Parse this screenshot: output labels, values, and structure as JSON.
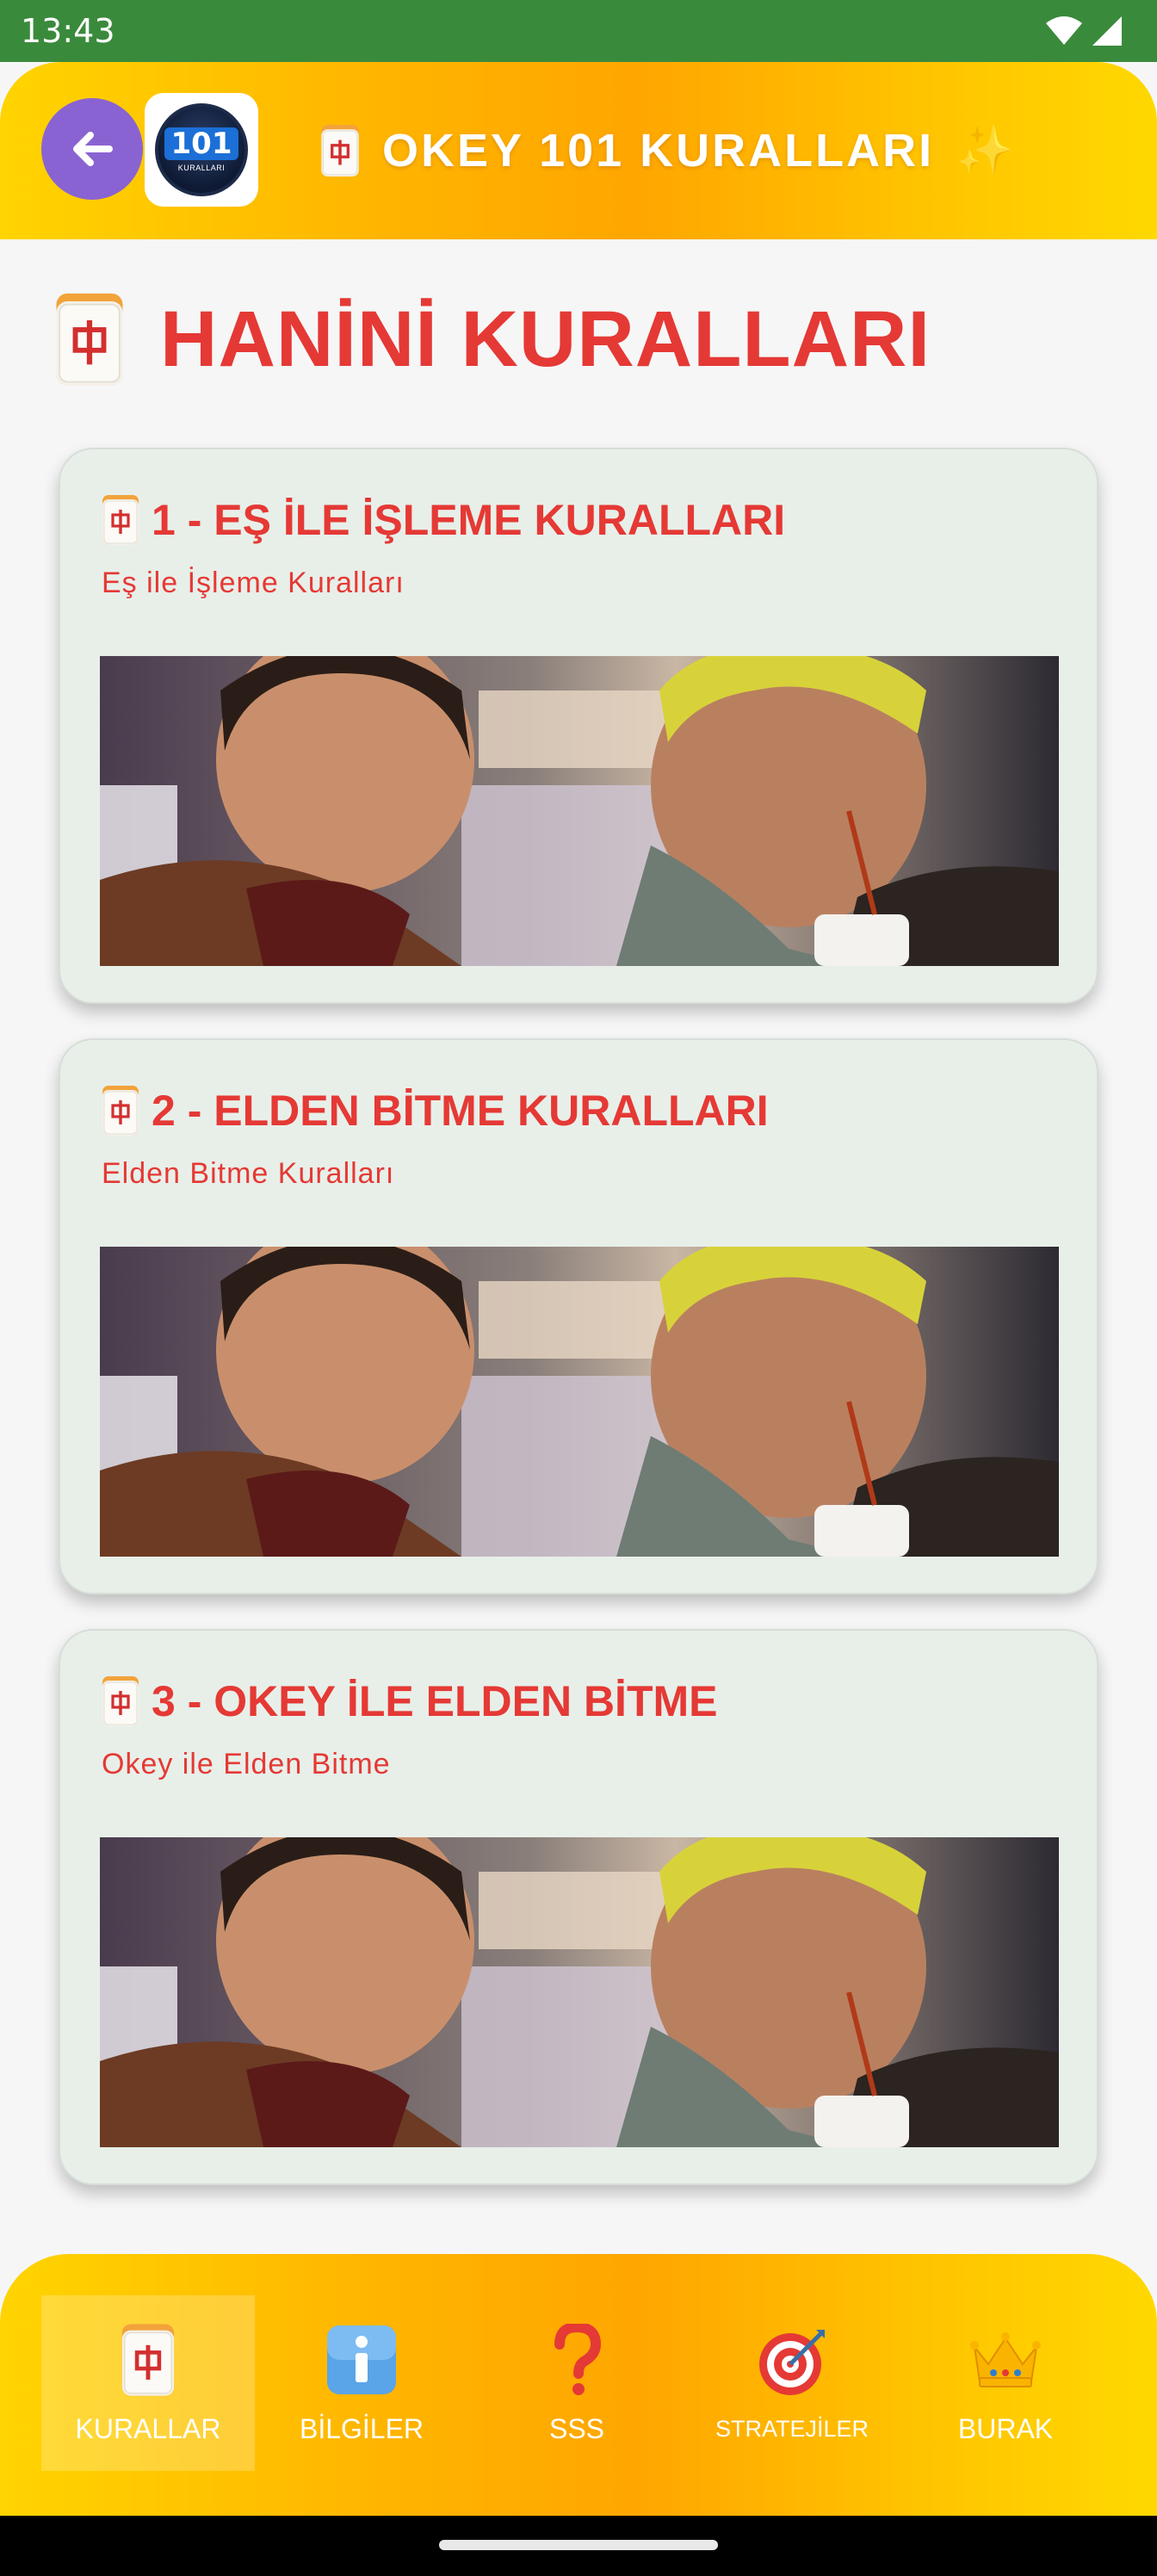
{
  "status_bar": {
    "time": "13:43"
  },
  "header": {
    "title": "OKEY 101 KURALLARI",
    "sparkle": "✨",
    "logo_number": "101",
    "logo_subtitle": "KURALLARI"
  },
  "page": {
    "title": "HANİNİ KURALLARI"
  },
  "cards": [
    {
      "title": "1 - EŞ İLE İŞLEME KURALLARI",
      "subtitle": "Eş ile İşleme Kuralları"
    },
    {
      "title": "2 - ELDEN BİTME KURALLARI",
      "subtitle": "Elden Bitme Kuralları"
    },
    {
      "title": "3 - OKEY İLE ELDEN BİTME",
      "subtitle": "Okey ile Elden Bitme"
    }
  ],
  "bottom_nav": [
    {
      "label": "KURALLAR",
      "icon": "mahjong-tile-icon",
      "active": true
    },
    {
      "label": "BİLGİLER",
      "icon": "info-icon",
      "active": false
    },
    {
      "label": "SSS",
      "icon": "question-icon",
      "active": false
    },
    {
      "label": "STRATEJİLER",
      "icon": "target-icon",
      "active": false
    },
    {
      "label": "BURAK",
      "icon": "crown-icon",
      "active": false
    }
  ],
  "colors": {
    "accent_red": "#e53935",
    "header_yellow": "#ffd400",
    "header_orange": "#ffa600",
    "back_button": "#8a63d2",
    "card_bg": "#e8efe9",
    "status_bar": "#3a8a3c"
  }
}
